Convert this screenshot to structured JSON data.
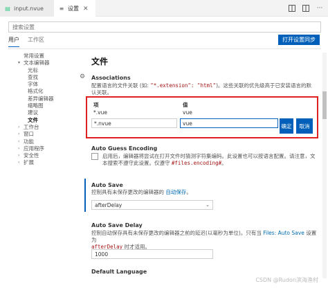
{
  "tabs": {
    "file_tab": {
      "label": "input.nvue",
      "icon": "file-icon"
    },
    "settings_tab": {
      "label": "设置",
      "icon": "settings-file-icon"
    },
    "actions": [
      "split-editor-icon",
      "more-actions-icon"
    ]
  },
  "search": {
    "placeholder": "搜索设置"
  },
  "scope": {
    "user": "用户",
    "workspace": "工作区",
    "sync_button": "打开设置同步"
  },
  "toc": {
    "items": [
      {
        "label": "常用设置",
        "indent": 1,
        "chevron": ""
      },
      {
        "label": "文本编辑器",
        "indent": 1,
        "chevron": "v"
      },
      {
        "label": "光标",
        "indent": 2,
        "chevron": ""
      },
      {
        "label": "查找",
        "indent": 2,
        "chevron": ""
      },
      {
        "label": "字体",
        "indent": 2,
        "chevron": ""
      },
      {
        "label": "格式化",
        "indent": 2,
        "chevron": ""
      },
      {
        "label": "差异编辑器",
        "indent": 2,
        "chevron": ""
      },
      {
        "label": "缩略图",
        "indent": 2,
        "chevron": ""
      },
      {
        "label": "建议",
        "indent": 2,
        "chevron": ""
      },
      {
        "label": "文件",
        "indent": 2,
        "chevron": "",
        "bold": true
      },
      {
        "label": "工作台",
        "indent": 1,
        "chevron": ">"
      },
      {
        "label": "窗口",
        "indent": 1,
        "chevron": ">"
      },
      {
        "label": "功能",
        "indent": 1,
        "chevron": ">"
      },
      {
        "label": "应用程序",
        "indent": 1,
        "chevron": ">"
      },
      {
        "label": "安全性",
        "indent": 1,
        "chevron": ">"
      },
      {
        "label": "扩展",
        "indent": 1,
        "chevron": ">"
      }
    ]
  },
  "main": {
    "section_title": "文件",
    "associations": {
      "title": "Associations",
      "desc_prefix": "配置语言的文件关联 (如: ",
      "desc_code": "\"*.extension\": \"html\"",
      "desc_suffix": ")。这些关联的优先级高于已安装语言的默认关联。",
      "col_item": "项",
      "col_value": "值",
      "row_key": "*.vue",
      "row_value": "vue",
      "edit_key": "*.nvue",
      "edit_value": "vue",
      "ok": "确定",
      "cancel": "取消"
    },
    "auto_guess": {
      "title": "Auto Guess Encoding",
      "desc1": "启用后，编辑器将尝试在打开文件时猜测字符集编码。此设置也可以按语言配置。请注意，文",
      "desc2_prefix": "本搜索不遵守此设置。仅遵守 ",
      "desc2_code": "#files.encoding#",
      "desc2_suffix": "。"
    },
    "auto_save": {
      "title": "Auto Save",
      "desc_prefix": "控制具有未保存更改的编辑器的 ",
      "desc_link": "自动保存",
      "desc_suffix": "。",
      "value": "afterDelay"
    },
    "auto_save_delay": {
      "title": "Auto Save Delay",
      "desc1_prefix": "控制自动保存具有未保存更改的编辑器之前的延迟(以毫秒为单位)。只有当 ",
      "desc1_link": "Files: Auto Save",
      "desc1_suffix": " 设置为",
      "desc2_code": "afterDelay",
      "desc2_suffix": " 时才适用。",
      "value": "1000"
    },
    "default_language": {
      "title": "Default Language"
    }
  },
  "watermark": "CSDN @Rudon滨海渔村"
}
